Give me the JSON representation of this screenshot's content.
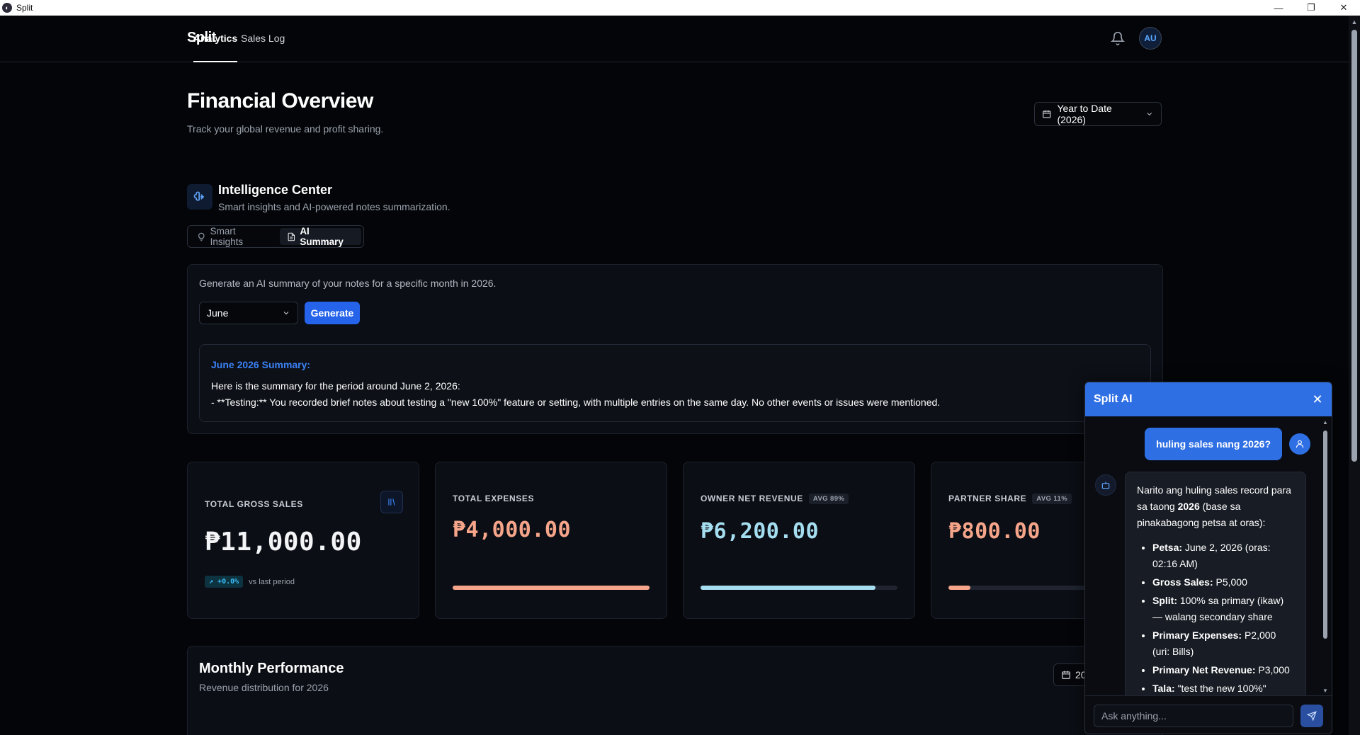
{
  "window": {
    "title": "Split",
    "controls": [
      "—",
      "❐",
      "✕"
    ]
  },
  "nav": {
    "brand": "Split",
    "links": [
      "Analytics",
      "Sales Log"
    ],
    "avatar": "AU"
  },
  "header": {
    "title": "Financial Overview",
    "subtitle": "Track your global revenue and profit sharing.",
    "range": "Year to Date (2026)"
  },
  "intelligence": {
    "title": "Intelligence Center",
    "subtitle": "Smart insights and AI-powered notes summarization.",
    "tabs": [
      "Smart Insights",
      "AI Summary"
    ],
    "active_tab": "AI Summary"
  },
  "ai_summary": {
    "description": "Generate an AI summary of your notes for a specific month in 2026.",
    "month": "June",
    "generate_label": "Generate",
    "result_title": "June 2026 Summary:",
    "result_line1": "Here is the summary for the period around June 2, 2026:",
    "result_line2": "- **Testing:** You recorded brief notes about testing a \"new 100%\" feature or setting, with multiple entries on the same day. No other events or issues were mentioned."
  },
  "stats": {
    "gross": {
      "label": "TOTAL GROSS SALES",
      "value": "₱11,000.00",
      "trend": "+0.0%",
      "trend_note": "vs last period"
    },
    "expenses": {
      "label": "TOTAL EXPENSES",
      "value": "₱4,000.00",
      "progress": 1.0,
      "color": "#f6a58a"
    },
    "owner": {
      "label": "OWNER NET REVENUE",
      "badge": "AVG 89%",
      "value": "₱6,200.00",
      "progress": 0.89,
      "color": "#a5def0"
    },
    "partner": {
      "label": "PARTNER SHARE",
      "badge": "AVG 11%",
      "value": "₱800.00",
      "progress": 0.11,
      "color": "#f6a58a"
    }
  },
  "performance": {
    "title": "Monthly Performance",
    "subtitle": "Revenue distribution for 2026",
    "year_partial": "20"
  },
  "chat": {
    "title": "Split AI",
    "user_message": "huling sales nang 2026?",
    "bot_intro_pre": "Narito ang huling sales record para sa taong ",
    "bot_intro_bold": "2026",
    "bot_intro_post": " (base sa pinakabagong petsa at oras):",
    "items": [
      {
        "k": "Petsa:",
        "v": " June 2, 2026 (oras: 02:16 AM)"
      },
      {
        "k": "Gross Sales:",
        "v": " P5,000"
      },
      {
        "k": "Split:",
        "v": " 100% sa primary (ikaw) — walang secondary share"
      },
      {
        "k": "Primary Expenses:",
        "v": " P2,000 (uri: Bills)"
      },
      {
        "k": "Primary Net Revenue:",
        "v": " P3,000"
      },
      {
        "k": "Tala:",
        "v": " \"test the new 100%\""
      }
    ],
    "placeholder": "Ask anything..."
  }
}
